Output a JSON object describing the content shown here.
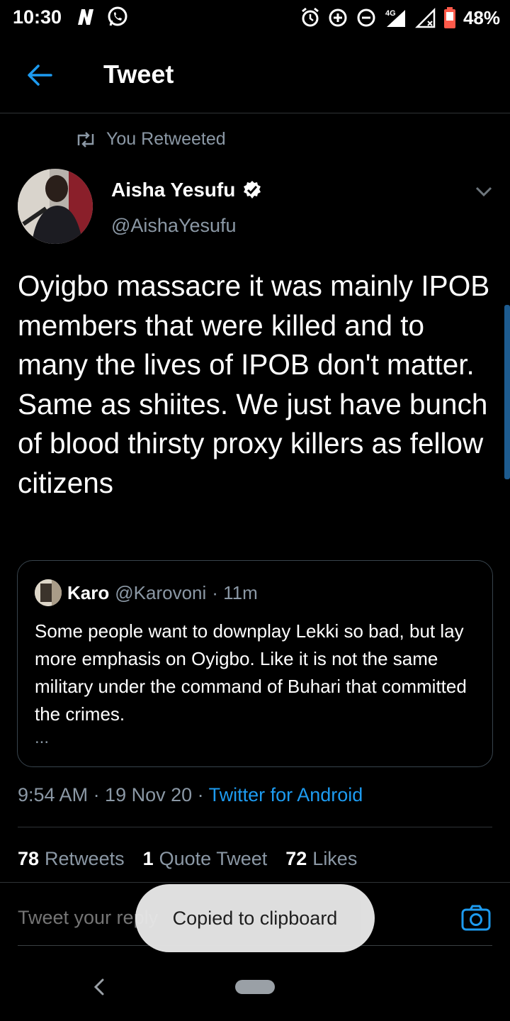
{
  "status_bar": {
    "time": "10:30",
    "left_icons": [
      "netflix-n-icon",
      "whatsapp-icon"
    ],
    "right_icons": [
      "alarm-icon",
      "data-saver-icon",
      "do-not-disturb-icon",
      "signal-4g-icon",
      "signal-icon",
      "battery-icon"
    ],
    "network": "4G",
    "battery": "48%"
  },
  "header": {
    "title": "Tweet",
    "back_icon": "back-arrow-icon"
  },
  "retweet": {
    "label": "You Retweeted",
    "icon": "retweet-icon"
  },
  "author": {
    "name": "Aisha Yesufu",
    "handle": "@AishaYesufu",
    "verified": true
  },
  "tweet": {
    "text": "Oyigbo massacre it was mainly IPOB members that were killed and to many the lives of IPOB don't matter. Same as shiites. We just have bunch of blood thirsty proxy killers as fellow citizens"
  },
  "quote": {
    "name": "Karo",
    "handle": "@Karovoni",
    "time": "· 11m",
    "text": "Some people want to downplay Lekki so bad, but lay more emphasis on Oyigbo. Like it is not the same military under the command of Buhari that committed the crimes.",
    "more": "..."
  },
  "meta": {
    "time": "9:54 AM · 19 Nov 20 · ",
    "source": "Twitter for Android"
  },
  "stats": {
    "retweets_count": "78",
    "retweets_label": "Retweets",
    "quotes_count": "1",
    "quotes_label": "Quote Tweet",
    "likes_count": "72",
    "likes_label": "Likes"
  },
  "reply": {
    "placeholder": "Tweet your reply"
  },
  "toast": {
    "text": "Copied to clipboard"
  },
  "colors": {
    "accent": "#1d9bf0",
    "background": "#000000",
    "muted": "#8b98a5"
  }
}
